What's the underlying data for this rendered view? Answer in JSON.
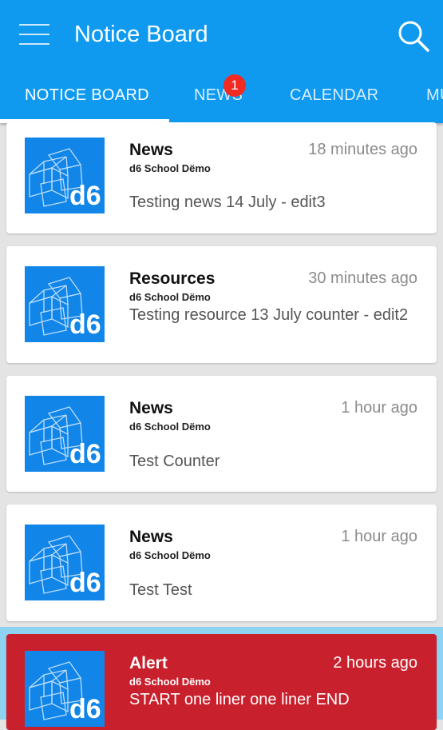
{
  "app_bar": {
    "title": "Notice Board",
    "menu_icon": "hamburger-menu-icon",
    "search_icon": "search-icon",
    "color": "#0f9af0"
  },
  "tabs": [
    {
      "label": "NOTICE BOARD",
      "active": true
    },
    {
      "label": "NEWS",
      "badge": "1"
    },
    {
      "label": "CALENDAR"
    },
    {
      "label": "MU"
    }
  ],
  "notices": [
    {
      "title": "News",
      "source": "d6 School Dëmo",
      "time": "18 minutes ago",
      "body": "Testing news 14 July - edit3",
      "logo": "d6"
    },
    {
      "title": "Resources",
      "source": "d6 School Dëmo",
      "time": "30 minutes ago",
      "body": "Testing resource 13 July counter - edit2",
      "logo": "d6"
    },
    {
      "title": "News",
      "source": "d6 School Dëmo",
      "time": "1 hour ago",
      "body": "Test Counter",
      "logo": "d6"
    },
    {
      "title": "News",
      "source": "d6 School Dëmo",
      "time": "1 hour ago",
      "body": "Test Test",
      "logo": "d6"
    },
    {
      "title": "Alert",
      "source": "d6 School Dëmo",
      "time": "2 hours ago",
      "body": "START one liner one liner END",
      "logo": "d6",
      "highlight_color": "#c9202d"
    }
  ]
}
